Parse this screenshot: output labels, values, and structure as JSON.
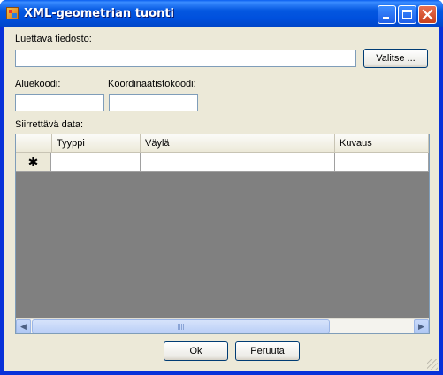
{
  "window": {
    "title": "XML-geometrian tuonti",
    "controls": {
      "minimize": "minimize-icon",
      "maximize": "maximize-icon",
      "close": "close-icon"
    }
  },
  "file": {
    "label": "Luettava tiedosto:",
    "value": "",
    "browse_label": "Valitse ..."
  },
  "area": {
    "label": "Aluekoodi:",
    "value": ""
  },
  "coords": {
    "label": "Koordinaatistokoodi:",
    "value": ""
  },
  "grid": {
    "label": "Siirrettävä data:",
    "columns": [
      "Tyyppi",
      "Väylä",
      "Kuvaus"
    ],
    "new_row_marker": "✱",
    "rows": []
  },
  "buttons": {
    "ok": "Ok",
    "cancel": "Peruuta"
  },
  "colors": {
    "titlebar": "#0054e3",
    "client": "#ece9d8",
    "grid_background": "#808080"
  }
}
